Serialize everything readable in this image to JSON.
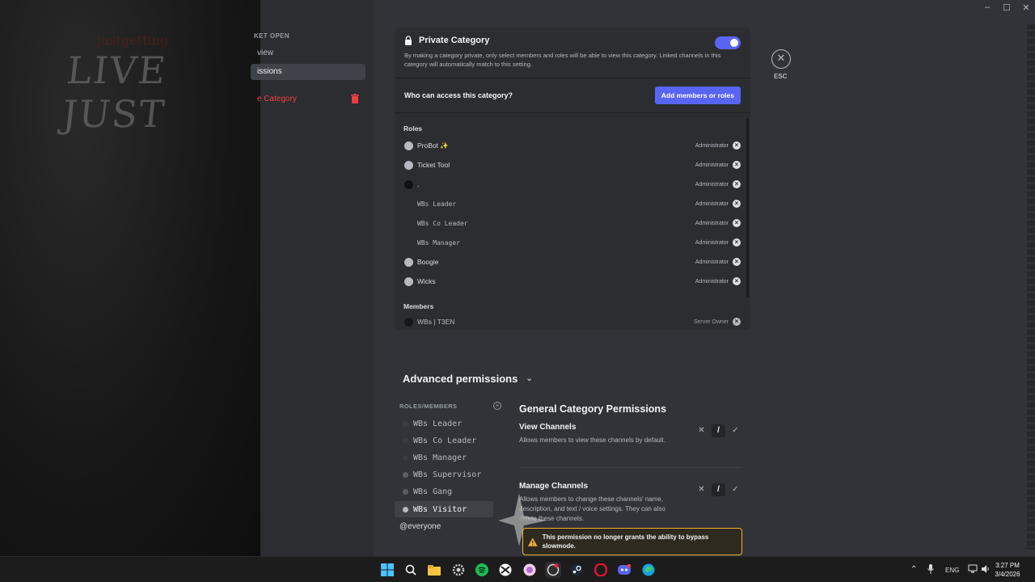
{
  "window": {
    "minimize_label": "–",
    "maximize_label": "☐",
    "close_label": "✕"
  },
  "background": {
    "grunge_title": "LIVE JUST",
    "grunge_sub": "justgetting"
  },
  "sidebar": {
    "header": "KET OPEN",
    "items": [
      {
        "label": "view"
      },
      {
        "label": "issions"
      },
      {
        "label": "e Category"
      }
    ]
  },
  "private_category": {
    "title": "Private Category",
    "enabled": true,
    "description": "By making a category private, only select members and roles will be able to view this category. Linked channels in this category will automatically match to this setting.",
    "who_label": "Who can access this category?",
    "add_button": "Add members or roles",
    "roles_label": "Roles",
    "roles": [
      {
        "name": "ProBot ✨",
        "permission": "Administrator",
        "icon": "avatar-icon",
        "mono": false
      },
      {
        "name": "Ticket Tool",
        "permission": "Administrator",
        "icon": "avatar-icon",
        "mono": false
      },
      {
        "name": ".",
        "permission": "Administrator",
        "icon": "avatar-dark-icon",
        "mono": false
      },
      {
        "name": "WBs Leader",
        "permission": "Administrator",
        "icon": "none",
        "mono": true
      },
      {
        "name": "WBs Co Leader",
        "permission": "Administrator",
        "icon": "none",
        "mono": true
      },
      {
        "name": "WBs Manager",
        "permission": "Administrator",
        "icon": "none",
        "mono": true
      },
      {
        "name": "Boogie",
        "permission": "Administrator",
        "icon": "avatar-icon",
        "mono": false
      },
      {
        "name": "Wicks",
        "permission": "Administrator",
        "icon": "avatar-icon",
        "mono": false
      }
    ],
    "members_label": "Members",
    "members": [
      {
        "name": "WBs | T3EN",
        "permission": "Server Owner"
      }
    ]
  },
  "close": {
    "label": "ESC",
    "icon": "✕"
  },
  "advanced": {
    "title": "Advanced permissions",
    "roles_members_header": "ROLES/MEMBERS",
    "list": [
      {
        "name": "WBs Leader",
        "dot": "dark"
      },
      {
        "name": "WBs Co Leader",
        "dot": "dark"
      },
      {
        "name": "WBs Manager",
        "dot": "dark"
      },
      {
        "name": "WBs Supervisor",
        "dot": "grey"
      },
      {
        "name": "WBs Gang",
        "dot": "grey"
      },
      {
        "name": "WBs Visitor",
        "dot": "light"
      }
    ],
    "everyone": "@everyone",
    "section_title": "General Category Permissions",
    "permissions": [
      {
        "name": "View Channels",
        "description": "Allows members to view these channels by default."
      },
      {
        "name": "Manage Channels",
        "description": "Allows members to change these channels' name, description, and text / voice settings. They can also delete these channels."
      }
    ],
    "warning": "This permission no longer grants the ability to bypass slowmode."
  },
  "taskbar": {
    "lang": "ENG",
    "time": "3:27 PM",
    "date": "3/4/2026"
  },
  "colors": {
    "accent": "#5865f2",
    "danger": "#f23f42",
    "warning": "#f0b232"
  }
}
